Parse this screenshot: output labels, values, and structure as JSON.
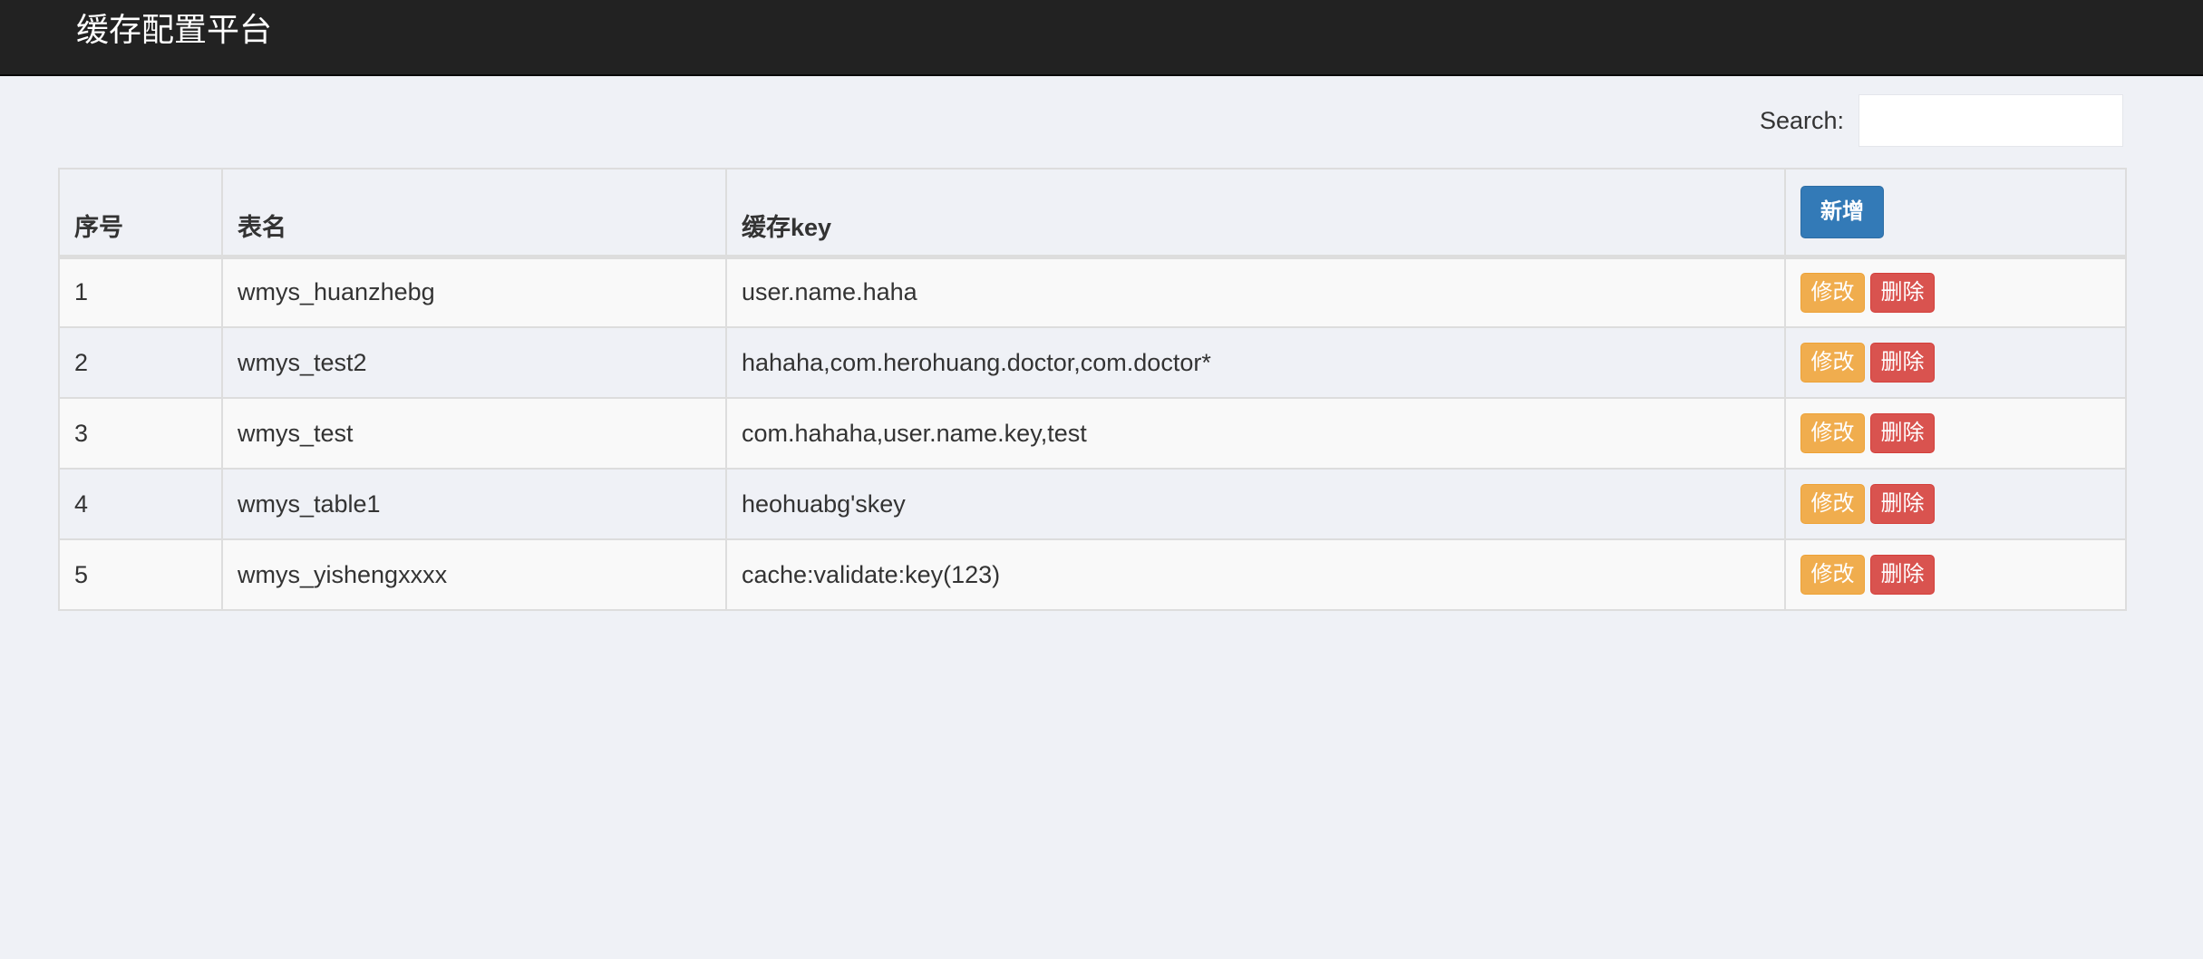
{
  "header": {
    "title": "缓存配置平台"
  },
  "search": {
    "label": "Search:",
    "value": ""
  },
  "table": {
    "columns": [
      "序号",
      "表名",
      "缓存key"
    ],
    "add_label": "新增",
    "edit_label": "修改",
    "delete_label": "删除",
    "rows": [
      {
        "id": "1",
        "name": "wmys_huanzhebg",
        "key": "user.name.haha"
      },
      {
        "id": "2",
        "name": "wmys_test2",
        "key": "hahaha,com.herohuang.doctor,com.doctor*"
      },
      {
        "id": "3",
        "name": "wmys_test",
        "key": "com.hahaha,user.name.key,test"
      },
      {
        "id": "4",
        "name": "wmys_table1",
        "key": "heohuabg'skey"
      },
      {
        "id": "5",
        "name": "wmys_yishengxxxx",
        "key": "cache:validate:key(123)"
      }
    ]
  },
  "colors": {
    "navbar": "#222222",
    "primary": "#337ab7",
    "warning": "#f0ad4e",
    "danger": "#d9534f"
  }
}
